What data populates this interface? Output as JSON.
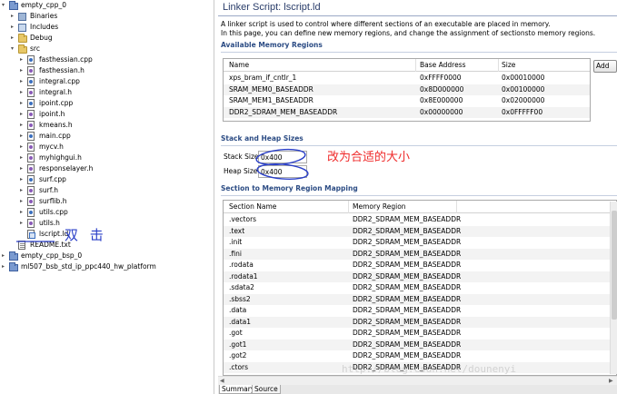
{
  "tree": {
    "items": [
      {
        "label": "empty_cpp_0",
        "icon": "project",
        "toggle": "▾",
        "depth": 0
      },
      {
        "label": "Binaries",
        "icon": "binaries",
        "toggle": "▸",
        "depth": 1
      },
      {
        "label": "Includes",
        "icon": "includes",
        "toggle": "▸",
        "depth": 1
      },
      {
        "label": "Debug",
        "icon": "folder",
        "toggle": "▸",
        "depth": 1
      },
      {
        "label": "src",
        "icon": "folder",
        "toggle": "▾",
        "depth": 1
      },
      {
        "label": "fasthessian.cpp",
        "icon": "cpp",
        "toggle": "▸",
        "depth": 2
      },
      {
        "label": "fasthessian.h",
        "icon": "h",
        "toggle": "▸",
        "depth": 2
      },
      {
        "label": "integral.cpp",
        "icon": "cpp",
        "toggle": "▸",
        "depth": 2
      },
      {
        "label": "integral.h",
        "icon": "h",
        "toggle": "▸",
        "depth": 2
      },
      {
        "label": "ipoint.cpp",
        "icon": "cpp",
        "toggle": "▸",
        "depth": 2
      },
      {
        "label": "ipoint.h",
        "icon": "h",
        "toggle": "▸",
        "depth": 2
      },
      {
        "label": "kmeans.h",
        "icon": "h",
        "toggle": "▸",
        "depth": 2
      },
      {
        "label": "main.cpp",
        "icon": "cpp",
        "toggle": "▸",
        "depth": 2
      },
      {
        "label": "mycv.h",
        "icon": "h",
        "toggle": "▸",
        "depth": 2
      },
      {
        "label": "myhighgui.h",
        "icon": "h",
        "toggle": "▸",
        "depth": 2
      },
      {
        "label": "responselayer.h",
        "icon": "h",
        "toggle": "▸",
        "depth": 2
      },
      {
        "label": "surf.cpp",
        "icon": "cpp",
        "toggle": "▸",
        "depth": 2
      },
      {
        "label": "surf.h",
        "icon": "h",
        "toggle": "▸",
        "depth": 2
      },
      {
        "label": "surflib.h",
        "icon": "h",
        "toggle": "▸",
        "depth": 2
      },
      {
        "label": "utils.cpp",
        "icon": "cpp",
        "toggle": "▸",
        "depth": 2
      },
      {
        "label": "utils.h",
        "icon": "h",
        "toggle": "▸",
        "depth": 2
      },
      {
        "label": "lscript.ld",
        "icon": "ld",
        "toggle": "",
        "depth": 2
      },
      {
        "label": "README.txt",
        "icon": "txt",
        "toggle": "",
        "depth": 1
      },
      {
        "label": "empty_cpp_bsp_0",
        "icon": "project",
        "toggle": "▸",
        "depth": 0
      },
      {
        "label": "ml507_bsb_std_ip_ppc440_hw_platform",
        "icon": "project",
        "toggle": "▸",
        "depth": 0
      }
    ]
  },
  "annotations": {
    "double_click": "双 击",
    "resize_note": "改为合适的大小",
    "watermark": "http://blog.csdn.net/dounenyi"
  },
  "editor": {
    "title": "Linker Script: lscript.ld",
    "description_1": "A linker script is used to control where different sections of an executable are placed in memory.",
    "description_2": "In this page, you can define new memory regions, and change the assignment of sectionsto memory regions.",
    "memory": {
      "heading": "Available Memory Regions",
      "columns": [
        "Name",
        "Base Address",
        "Size"
      ],
      "rows": [
        [
          "xps_bram_if_cntlr_1",
          "0xFFFF0000",
          "0x00010000"
        ],
        [
          "SRAM_MEM0_BASEADDR",
          "0x8D000000",
          "0x00100000"
        ],
        [
          "SRAM_MEM1_BASEADDR",
          "0x8E000000",
          "0x02000000"
        ],
        [
          "DDR2_SDRAM_MEM_BASEADDR",
          "0x00000000",
          "0x0FFFFF00"
        ]
      ],
      "add_button": "Add"
    },
    "stack_heap": {
      "heading": "Stack and Heap Sizes",
      "stack_label": "Stack Size",
      "stack_value": "0x400",
      "heap_label": "Heap Size",
      "heap_value": "0x400"
    },
    "mapping": {
      "heading": "Section to Memory Region Mapping",
      "columns": [
        "Section Name",
        "Memory Region"
      ],
      "rows": [
        [
          ".vectors",
          "DDR2_SDRAM_MEM_BASEADDR"
        ],
        [
          ".text",
          "DDR2_SDRAM_MEM_BASEADDR"
        ],
        [
          ".init",
          "DDR2_SDRAM_MEM_BASEADDR"
        ],
        [
          ".fini",
          "DDR2_SDRAM_MEM_BASEADDR"
        ],
        [
          ".rodata",
          "DDR2_SDRAM_MEM_BASEADDR"
        ],
        [
          ".rodata1",
          "DDR2_SDRAM_MEM_BASEADDR"
        ],
        [
          ".sdata2",
          "DDR2_SDRAM_MEM_BASEADDR"
        ],
        [
          ".sbss2",
          "DDR2_SDRAM_MEM_BASEADDR"
        ],
        [
          ".data",
          "DDR2_SDRAM_MEM_BASEADDR"
        ],
        [
          ".data1",
          "DDR2_SDRAM_MEM_BASEADDR"
        ],
        [
          ".got",
          "DDR2_SDRAM_MEM_BASEADDR"
        ],
        [
          ".got1",
          "DDR2_SDRAM_MEM_BASEADDR"
        ],
        [
          ".got2",
          "DDR2_SDRAM_MEM_BASEADDR"
        ],
        [
          ".ctors",
          "DDR2_SDRAM_MEM_BASEADDR"
        ]
      ]
    },
    "tabs": [
      "Summary",
      "Source"
    ]
  },
  "colors": {
    "section_heading": "#2c4c84",
    "annotation_red": "#ef2b2b",
    "annotation_blue": "#2a3fc8"
  }
}
